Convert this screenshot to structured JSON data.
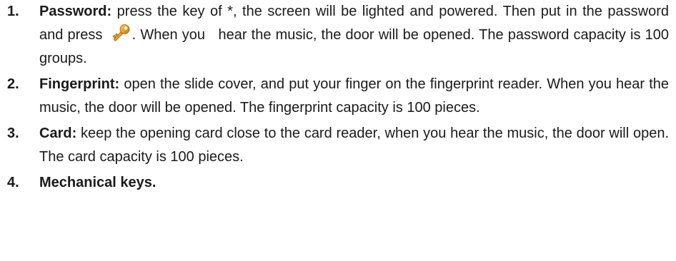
{
  "items": [
    {
      "number": "1.",
      "title": "Password",
      "separator": ":",
      "text_before_icon": " press the key of *, the screen will be lighted and powered. Then put in the password and press ",
      "icon": "key-icon",
      "text_after_icon": ". When you   hear the music, the door will be opened. The password capacity is 100 groups."
    },
    {
      "number": "2.",
      "title": "Fingerprint:",
      "text": " open the slide cover, and put your finger on the fingerprint reader. When you hear the music, the door will be opened. The fingerprint capacity is 100 pieces."
    },
    {
      "number": "3.",
      "title": "Card:",
      "text": " keep the opening card close to the card reader, when you hear the music, the door will open. The card capacity is 100 pieces."
    },
    {
      "number": "4.",
      "title": "Mechanical keys."
    }
  ]
}
